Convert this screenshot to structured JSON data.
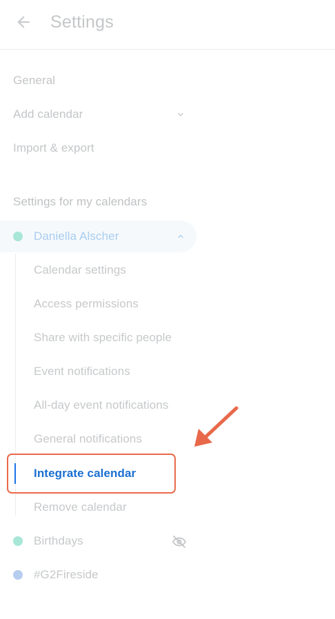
{
  "header": {
    "back_icon": "arrow-left-icon",
    "title": "Settings"
  },
  "nav": {
    "general": "General",
    "add_calendar": "Add calendar",
    "import_export": "Import & export"
  },
  "section": {
    "title": "Settings for my calendars"
  },
  "calendars": [
    {
      "name": "Daniella Alscher",
      "color": "#a8e6d8",
      "expanded": true,
      "subitems": [
        "Calendar settings",
        "Access permissions",
        "Share with specific people",
        "Event notifications",
        "All-day event notifications",
        "General notifications",
        "Integrate calendar",
        "Remove calendar"
      ],
      "selected": "Integrate calendar"
    },
    {
      "name": "Birthdays",
      "color": "#a8e6d8",
      "icon": "eye-off-icon"
    },
    {
      "name": "#G2Fireside",
      "color": "#b7cdf0"
    }
  ],
  "colors": {
    "accent": "#1a73e8",
    "annotation": "#e8694a"
  }
}
